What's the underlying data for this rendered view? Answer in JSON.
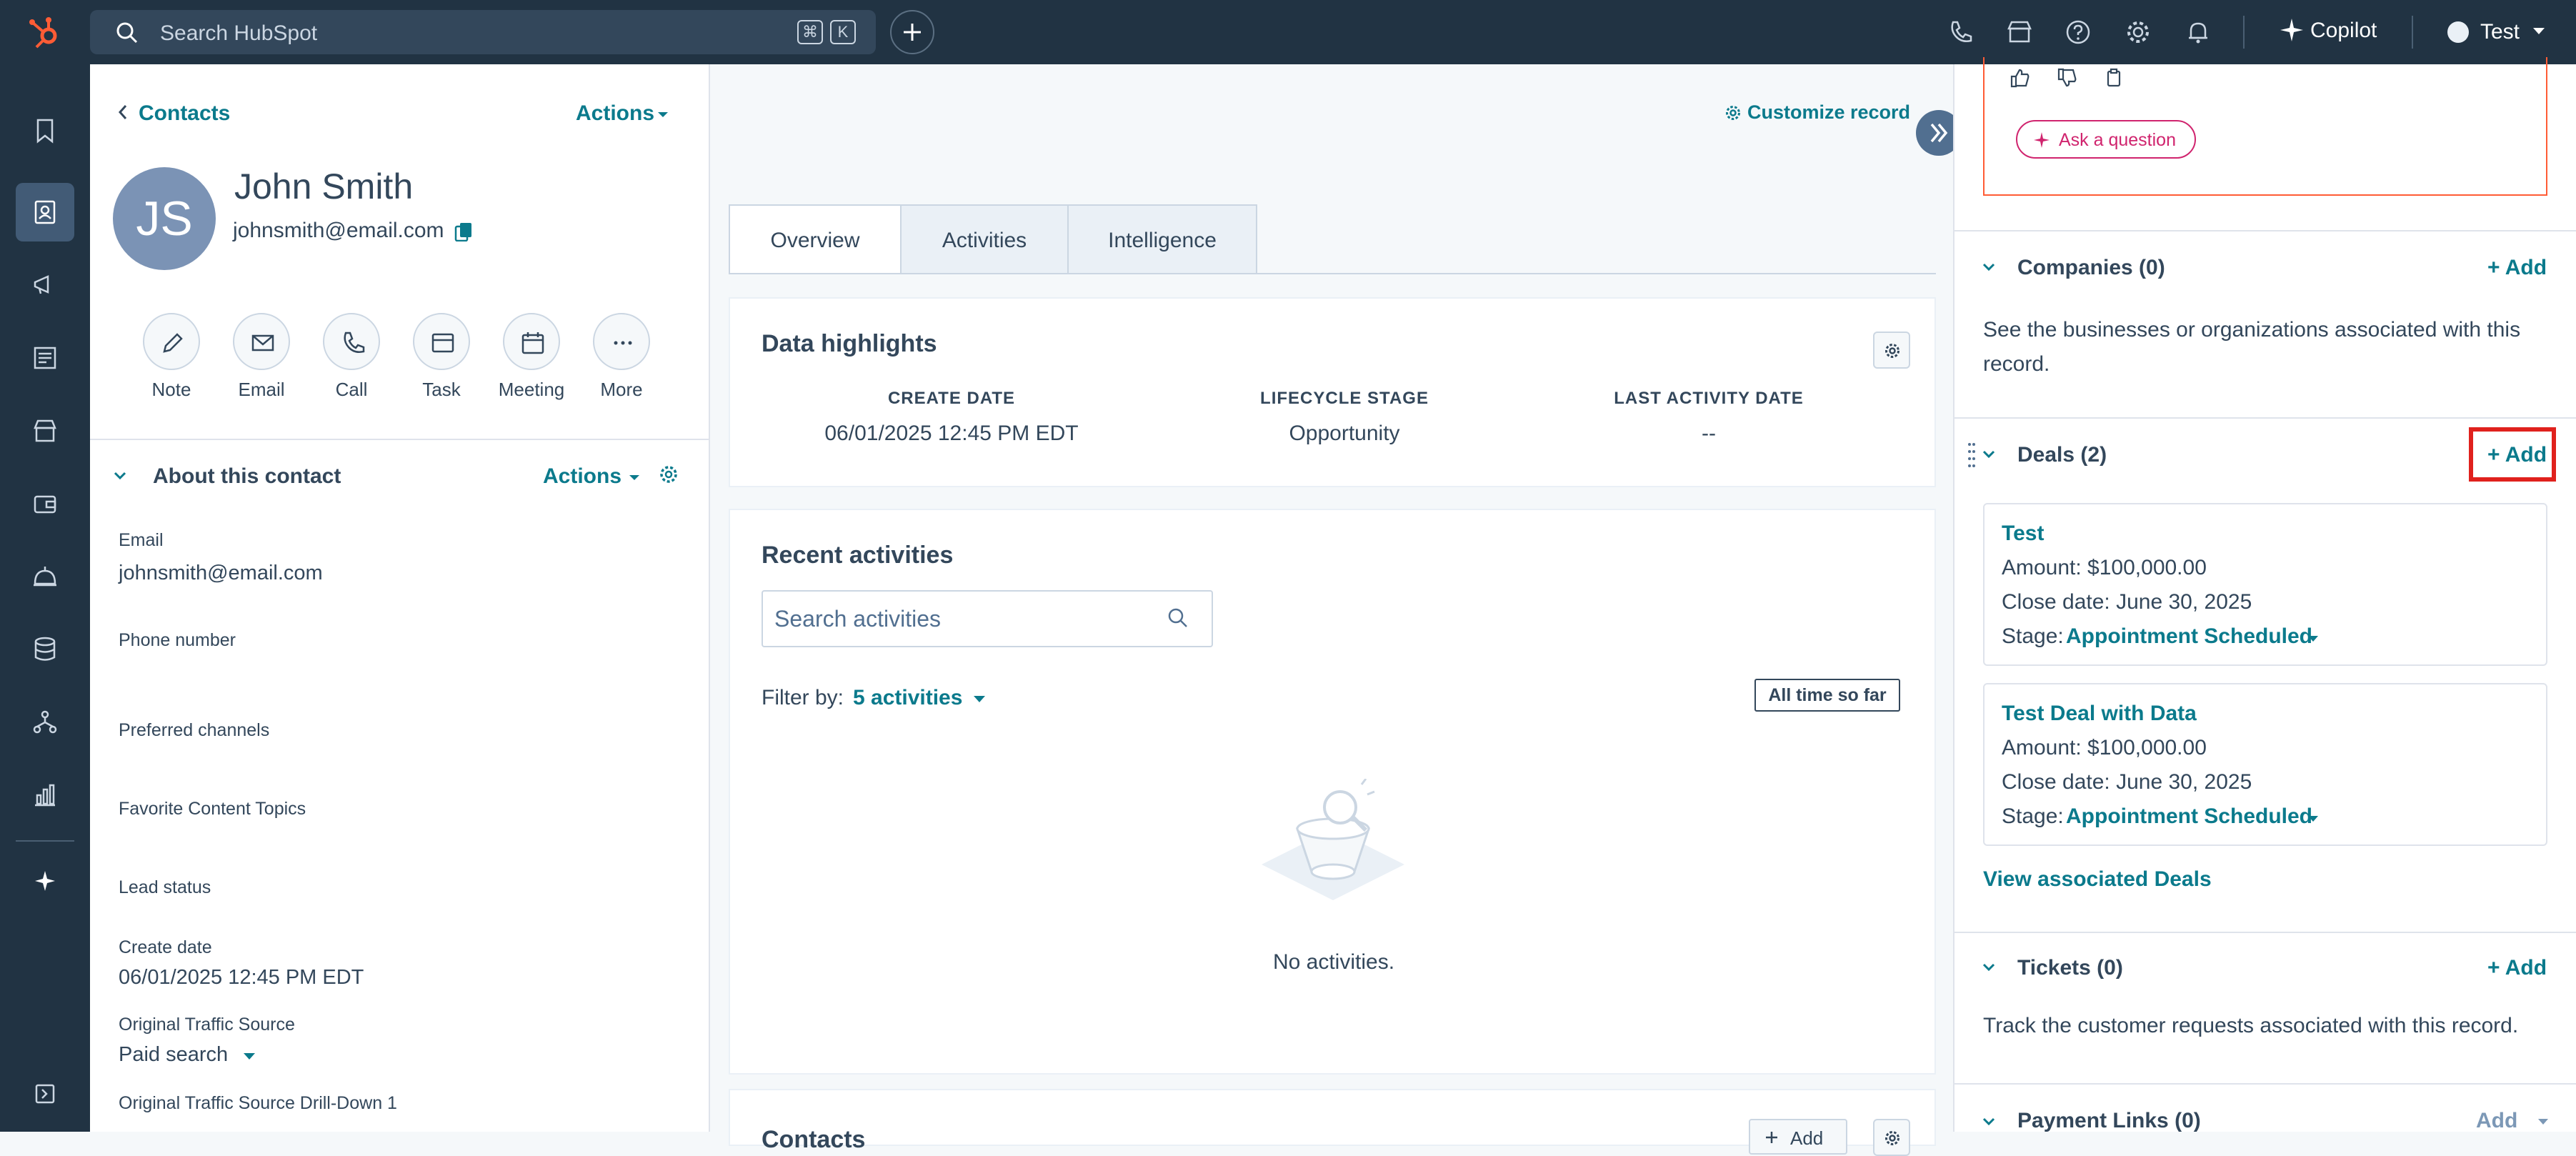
{
  "topbar": {
    "search_placeholder": "Search HubSpot",
    "kbd_cmd": "⌘",
    "kbd_k": "K",
    "copilot": "Copilot",
    "account": "Test"
  },
  "left": {
    "breadcrumb": "Contacts",
    "actions": "Actions",
    "avatar_initials": "JS",
    "name": "John Smith",
    "email": "johnsmith@email.com",
    "quick_actions": [
      "Note",
      "Email",
      "Call",
      "Task",
      "Meeting",
      "More"
    ],
    "about_title": "About this contact",
    "about_actions": "Actions",
    "props": {
      "email_label": "Email",
      "email_value": "johnsmith@email.com",
      "phone_label": "Phone number",
      "preferred_label": "Preferred channels",
      "topics_label": "Favorite Content Topics",
      "lead_label": "Lead status",
      "create_label": "Create date",
      "create_value": "06/01/2025 12:45 PM EDT",
      "traffic_label": "Original Traffic Source",
      "traffic_value": "Paid search",
      "drill_label": "Original Traffic Source Drill-Down 1"
    }
  },
  "middle": {
    "customize": "Customize record",
    "tabs": [
      "Overview",
      "Activities",
      "Intelligence"
    ],
    "highlights": {
      "title": "Data highlights",
      "col1_head": "CREATE DATE",
      "col1_val": "06/01/2025 12:45 PM EDT",
      "col2_head": "LIFECYCLE STAGE",
      "col2_val": "Opportunity",
      "col3_head": "LAST ACTIVITY DATE",
      "col3_val": "--"
    },
    "recent": {
      "title": "Recent activities",
      "search_placeholder": "Search activities",
      "filter_label": "Filter by:",
      "filter_value": "5 activities",
      "timeframe": "All time so far",
      "empty": "No activities."
    },
    "contacts": {
      "title": "Contacts",
      "add": "Add"
    }
  },
  "right": {
    "ask": "Ask a question",
    "companies": {
      "title": "Companies (0)",
      "add": "+ Add",
      "desc": "See the businesses or organizations associated with this record."
    },
    "deals": {
      "title": "Deals (2)",
      "add": "+ Add",
      "items": [
        {
          "name": "Test",
          "amount": "Amount: $100,000.00",
          "close": "Close date: June 30, 2025",
          "stage_label": "Stage:",
          "stage": "Appointment Scheduled"
        },
        {
          "name": "Test Deal with Data",
          "amount": "Amount: $100,000.00",
          "close": "Close date: June 30, 2025",
          "stage_label": "Stage:",
          "stage": "Appointment Scheduled"
        }
      ],
      "view_all": "View associated Deals"
    },
    "tickets": {
      "title": "Tickets (0)",
      "add": "+ Add",
      "desc": "Track the customer requests associated with this record."
    },
    "payment": {
      "title": "Payment Links (0)",
      "add": "Add"
    }
  },
  "colors": {
    "nav_bg": "#213343",
    "accent": "#0b7a8c",
    "brand_orange": "#ff5c35",
    "highlight_box": "#e0211d",
    "copilot_border": "#d0246e"
  }
}
